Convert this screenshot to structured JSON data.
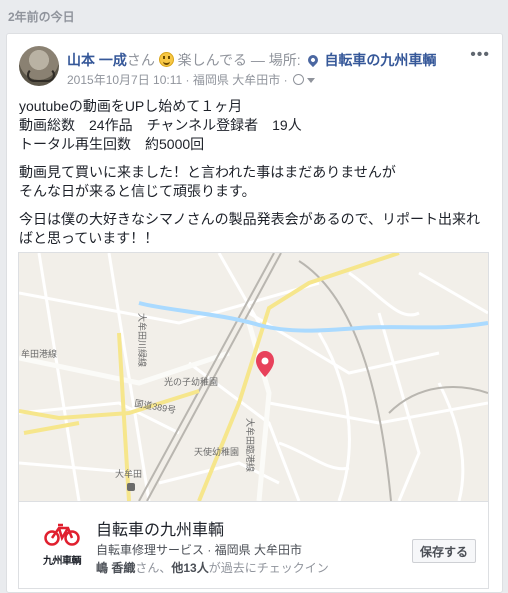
{
  "memory": {
    "header": "2年前の今日"
  },
  "post": {
    "author": "山本 一成",
    "author_suffix": "さん",
    "feeling": "楽しんでる",
    "location_separator": " — 場所:",
    "location": "自転車の九州車輌",
    "timestamp": "2015年10月7日 10:11",
    "meta_separator": "·",
    "meta_location": "福岡県 大牟田市",
    "privacy_separator": "·",
    "more_label": "•••",
    "body": [
      "youtubeの動画をUPし始めて１ヶ月",
      "動画総数　24作品　チャンネル登録者　19人",
      "トータル再生回数　約5000回",
      "動画見て買いに来ました！と言われた事はまだありませんが",
      "そんな日が来ると信じて頑張ります。",
      "今日は僕の大好きなシマノさんの製品発表会があるので、リポート出来れ",
      "ばと思っています！！"
    ]
  },
  "map": {
    "labels": {
      "omuta_river_line": "大牟田川緑線",
      "river_line_left": "牟田港線",
      "kindergarten_light": "光の子幼稚園",
      "national_route": "国道389号",
      "tenshi_kindergarten": "天使幼稚園",
      "omuta": "大牟田",
      "omuta_kaido": "大牟田臨港線"
    },
    "pin_color": "#e8415b"
  },
  "place": {
    "name": "自転車の九州車輌",
    "category": "自転車修理サービス · 福岡県 大牟田市",
    "checkin_name": "嶋 香織",
    "checkin_mid": "さん、",
    "checkin_others": "他13人",
    "checkin_suffix": "が過去にチェックイン",
    "logo_text": "九州車輌",
    "save_label": "保存する",
    "logo_color": "#e0202f"
  }
}
